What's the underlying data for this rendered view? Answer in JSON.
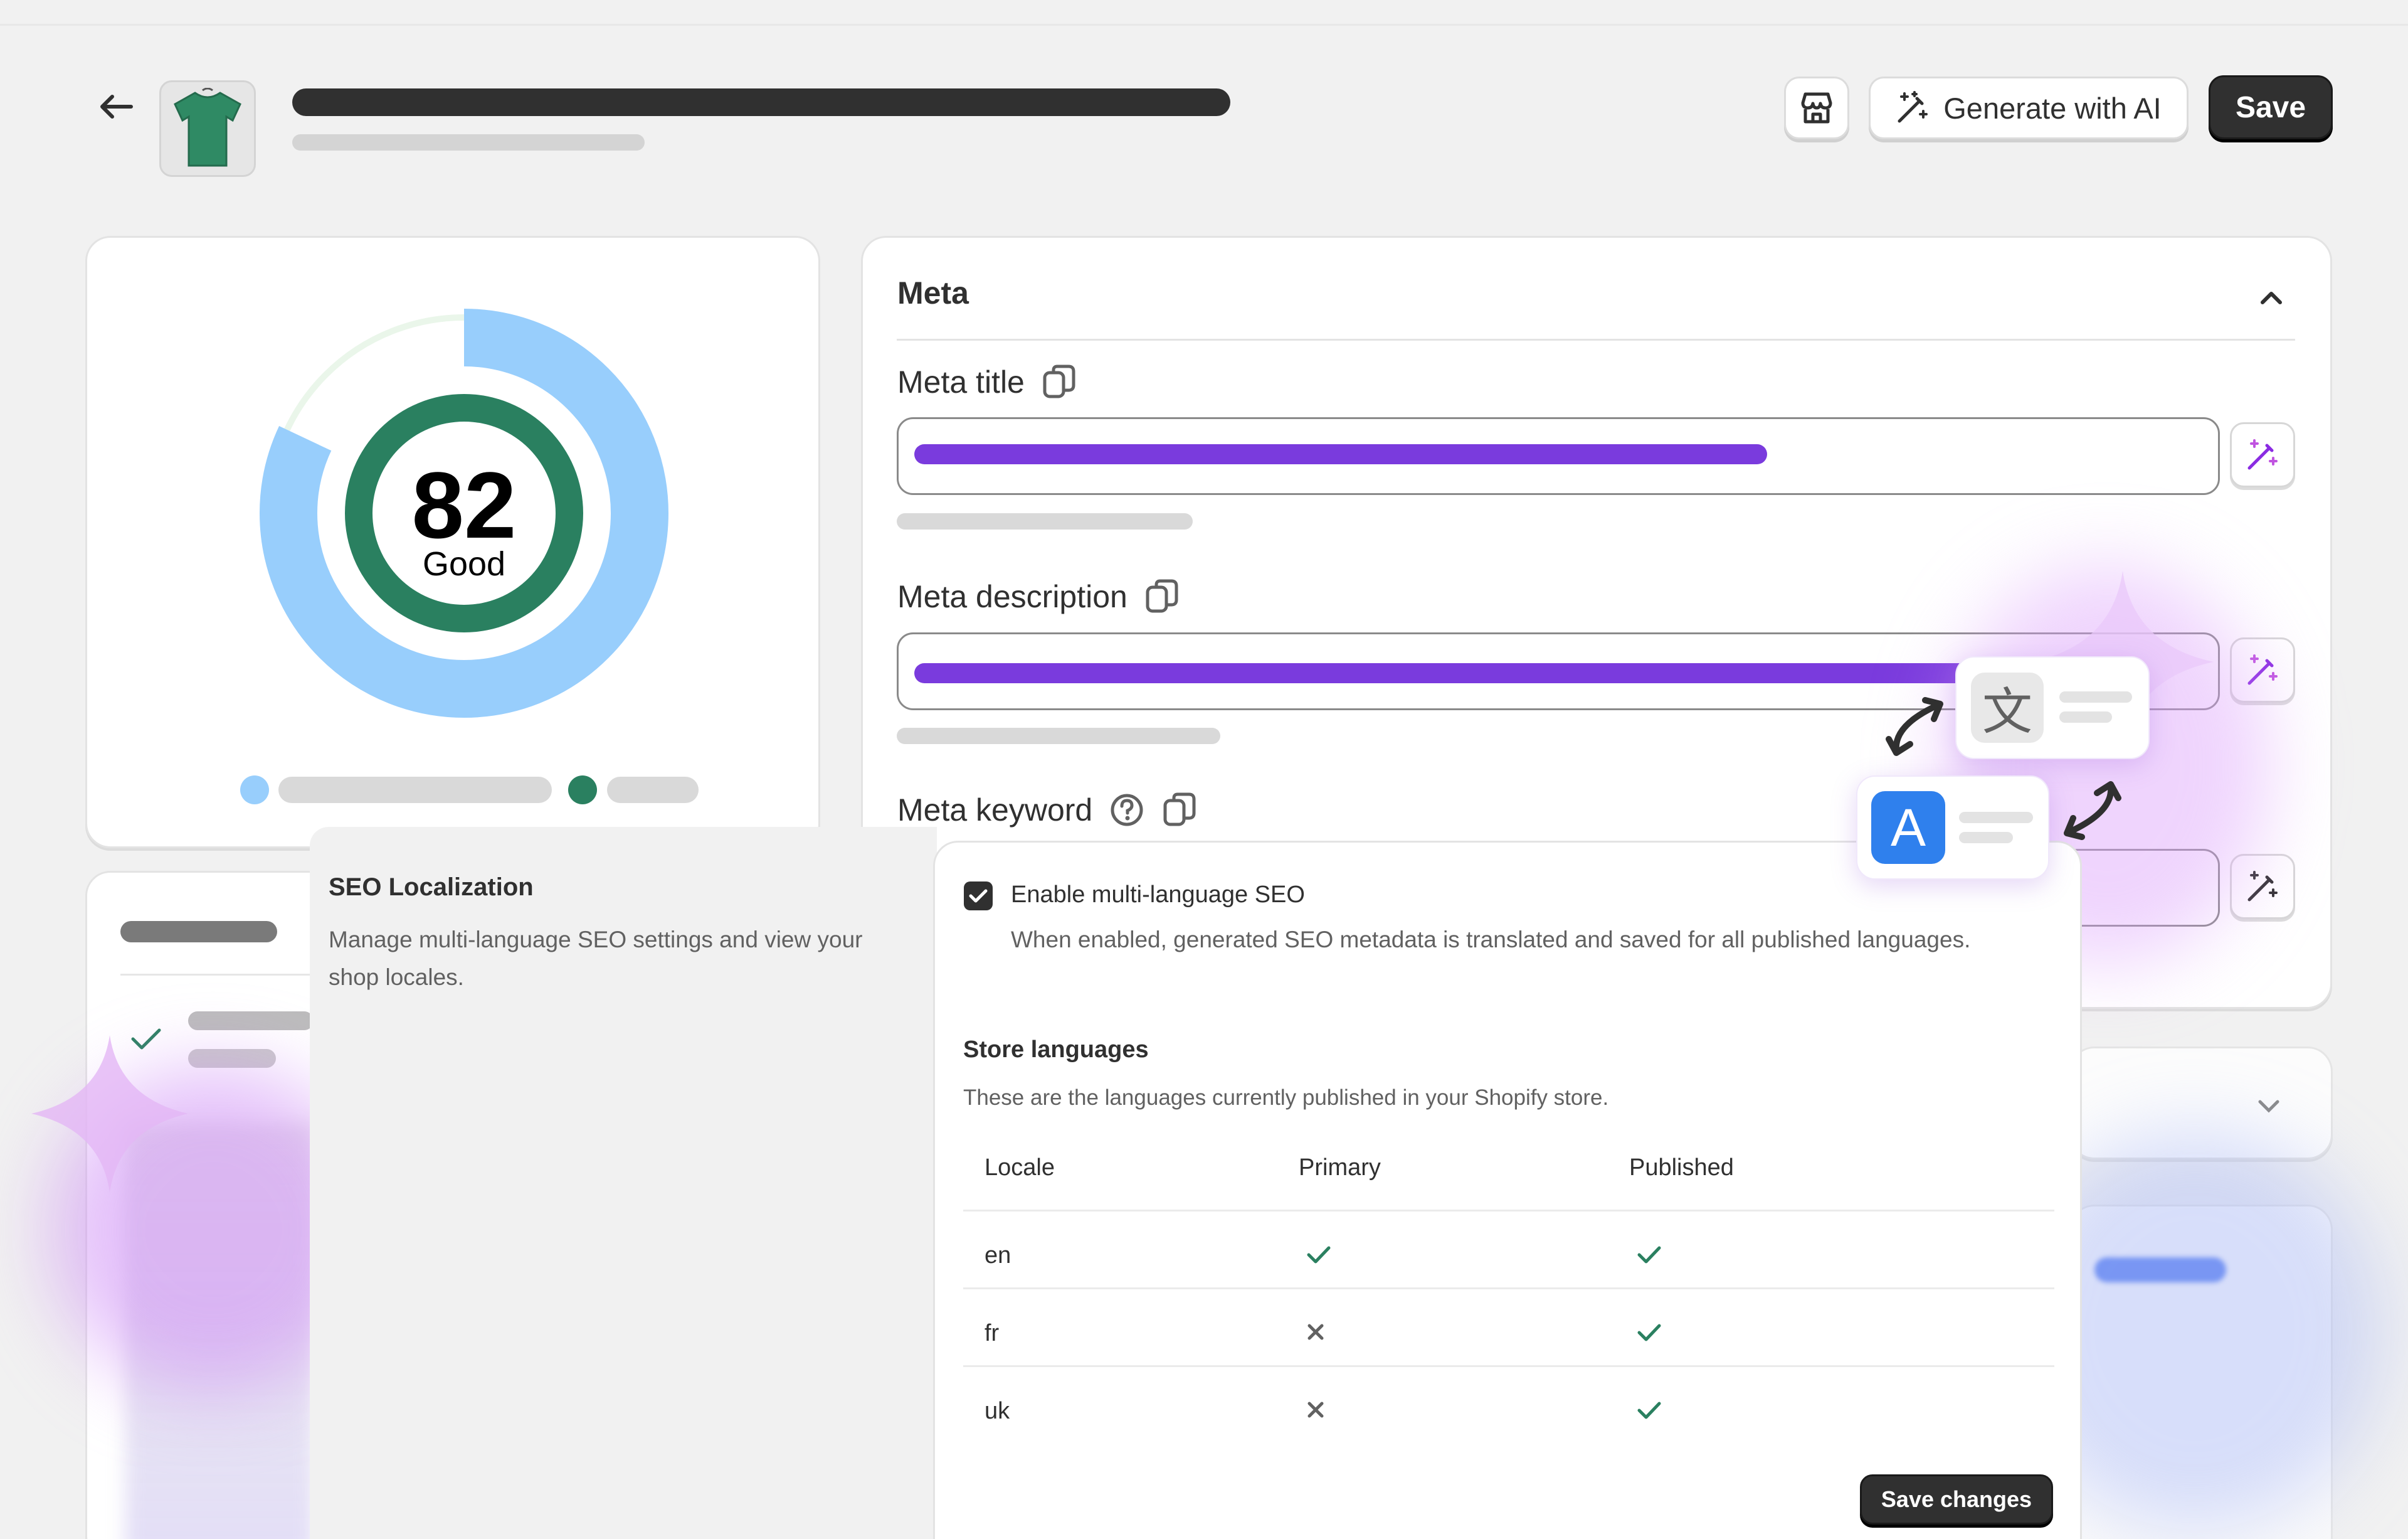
{
  "header": {
    "generate_label": "Generate with AI",
    "save_label": "Save"
  },
  "score": {
    "value": "82",
    "grade": "Good",
    "value_fraction": 0.82,
    "colors": {
      "ring": "#98cefc",
      "inner": "#2a8060",
      "track": "#eaf6ea"
    }
  },
  "meta": {
    "section_title": "Meta",
    "fields": {
      "title_label": "Meta title",
      "description_label": "Meta description",
      "keyword_label": "Meta keyword"
    },
    "accent": "#7a3bdd"
  },
  "localization": {
    "title": "SEO Localization",
    "description": "Manage multi-language SEO settings and view your shop locales.",
    "checkbox_label": "Enable multi-language SEO",
    "checkbox_checked": true,
    "checkbox_help": "When enabled, generated SEO metadata is translated and saved for all published languages.",
    "languages_title": "Store languages",
    "languages_desc": "These are the languages currently published in your Shopify store.",
    "columns": {
      "locale": "Locale",
      "primary": "Primary",
      "published": "Published"
    },
    "rows": [
      {
        "locale": "en",
        "primary": true,
        "published": true
      },
      {
        "locale": "fr",
        "primary": false,
        "published": true
      },
      {
        "locale": "uk",
        "primary": false,
        "published": true
      }
    ],
    "save_label": "Save changes"
  },
  "translate_widget": {
    "glyph_source": "文",
    "glyph_target": "A"
  }
}
